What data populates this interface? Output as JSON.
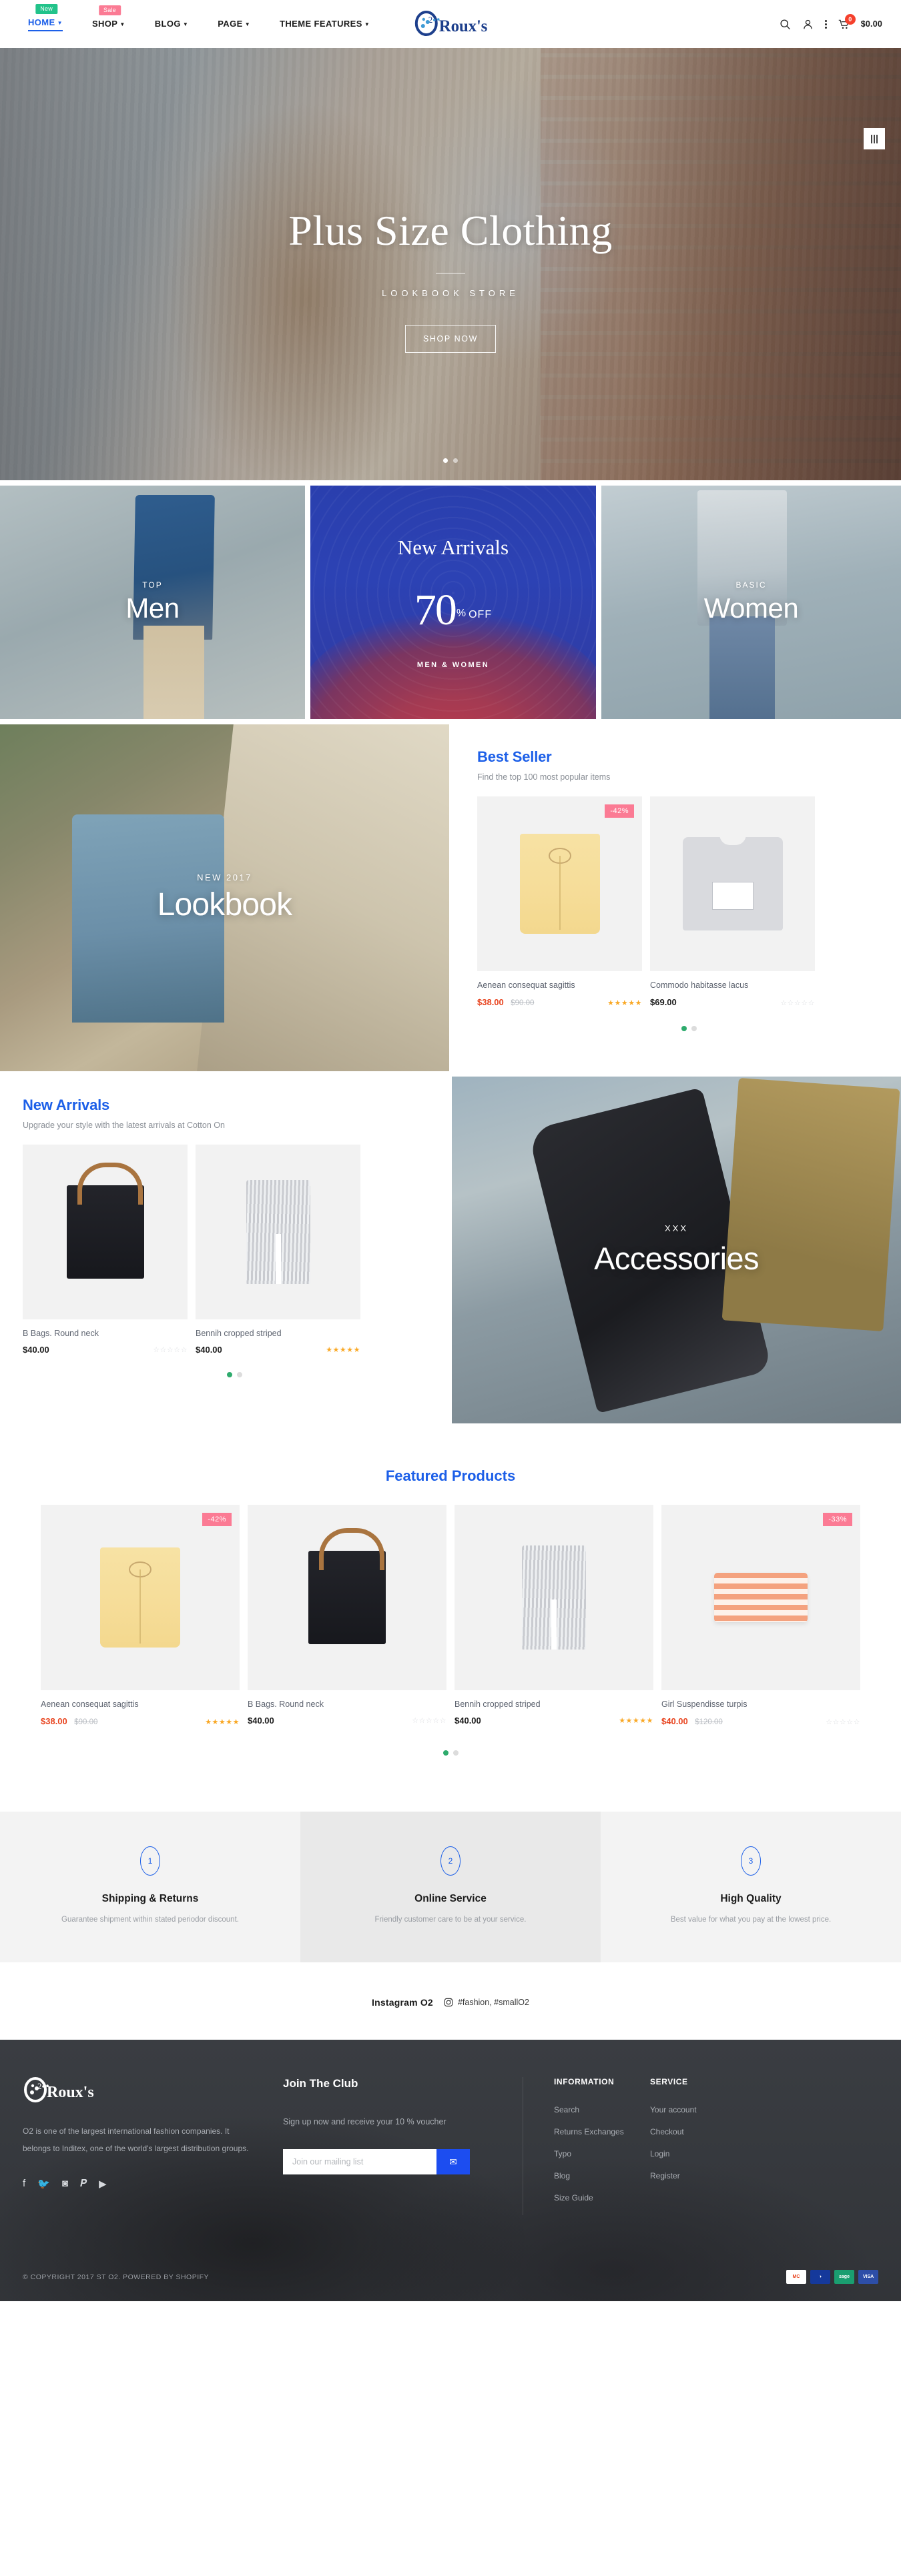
{
  "header": {
    "nav": [
      {
        "label": "HOME",
        "badge": "New",
        "badge_type": "new",
        "active": true,
        "caret": true
      },
      {
        "label": "SHOP",
        "badge": "Sale",
        "badge_type": "sale",
        "active": false,
        "caret": true
      },
      {
        "label": "BLOG",
        "badge": null,
        "active": false,
        "caret": true
      },
      {
        "label": "PAGE",
        "badge": null,
        "active": false,
        "caret": true
      },
      {
        "label": "THEME FEATURES",
        "badge": null,
        "active": false,
        "caret": true
      }
    ],
    "logo_text": "Roux's",
    "logo_mark": "o2-circle-logo",
    "icons": [
      "search-icon",
      "user-icon",
      "more-dots-icon",
      "cart-icon"
    ],
    "cart_count": "0",
    "cart_total": "$0.00"
  },
  "hero": {
    "title": "Plus Size Clothing",
    "subtitle": "LOOKBOOK STORE",
    "button": "SHOP NOW",
    "slides": 2,
    "active_slide": 1
  },
  "categories": [
    {
      "kicker": "TOP",
      "title": "Men"
    },
    {
      "kicker": "",
      "title": "New Arrivals",
      "percent": "70",
      "symbol": "%",
      "off": "OFF",
      "sub": "MEN & WOMEN"
    },
    {
      "kicker": "BASIC",
      "title": "Women"
    }
  ],
  "lookbook": {
    "kicker": "NEW 2017",
    "title": "Lookbook"
  },
  "best_seller": {
    "title": "Best Seller",
    "subtitle": "Find the top 100 most popular items",
    "products": [
      {
        "name": "Aenean consequat sagittis",
        "price": "$38.00",
        "old_price": "$90.00",
        "discount": "-42%",
        "rating": 4.5,
        "art": "shorts"
      },
      {
        "name": "Commodo habitasse lacus",
        "price": "$69.00",
        "old_price": null,
        "discount": null,
        "rating": 0,
        "art": "tee"
      }
    ],
    "dots": 2,
    "active_dot": 1
  },
  "new_arrivals": {
    "title": "New Arrivals",
    "subtitle": "Upgrade your style with the latest arrivals at Cotton On",
    "products": [
      {
        "name": "B Bags. Round neck",
        "price": "$40.00",
        "old_price": null,
        "discount": null,
        "rating": 0,
        "art": "bag"
      },
      {
        "name": "Bennih cropped striped",
        "price": "$40.00",
        "old_price": null,
        "discount": null,
        "rating": 5,
        "art": "pants"
      }
    ],
    "dots": 2,
    "active_dot": 1
  },
  "accessories": {
    "kicker": "XXX",
    "title": "Accessories"
  },
  "featured": {
    "title": "Featured Products",
    "products": [
      {
        "name": "Aenean consequat sagittis",
        "price": "$38.00",
        "old_price": "$90.00",
        "discount": "-42%",
        "rating": 4.5,
        "art": "shorts"
      },
      {
        "name": "B Bags. Round neck",
        "price": "$40.00",
        "old_price": null,
        "discount": null,
        "rating": 0,
        "art": "bag"
      },
      {
        "name": "Bennih cropped striped",
        "price": "$40.00",
        "old_price": null,
        "discount": null,
        "rating": 5,
        "art": "pants"
      },
      {
        "name": "Girl Suspendisse turpis",
        "price": "$40.00",
        "old_price": "$120.00",
        "discount": "-33%",
        "rating": 0,
        "art": "towel"
      }
    ],
    "dots": 2,
    "active_dot": 1
  },
  "services": [
    {
      "num": "1",
      "title": "Shipping & Returns",
      "text": "Guarantee shipment within stated periodor discount."
    },
    {
      "num": "2",
      "title": "Online Service",
      "text": "Friendly customer care to be at your service."
    },
    {
      "num": "3",
      "title": "High Quality",
      "text": "Best value for what you pay at the lowest price."
    }
  ],
  "instagram": {
    "title": "Instagram O2",
    "tags": "#fashion, #smallO2",
    "icon": "instagram-icon"
  },
  "footer": {
    "logo_text": "Roux's",
    "about": "O2 is one of the largest international fashion companies. It belongs to Inditex, one of the world's largest distribution groups.",
    "social": [
      "facebook-icon",
      "twitter-icon",
      "instagram-icon",
      "pinterest-icon",
      "youtube-icon"
    ],
    "club": {
      "title": "Join The Club",
      "text": "Sign up now and receive your 10 % voucher",
      "placeholder": "Join our mailing list",
      "submit_icon": "envelope-icon"
    },
    "information": {
      "head": "INFORMATION",
      "links": [
        "Search",
        "Returns Exchanges",
        "Typo",
        "Blog",
        "Size Guide"
      ]
    },
    "service": {
      "head": "SERVICE",
      "links": [
        "Your account",
        "Checkout",
        "Login",
        "Register"
      ]
    },
    "copyright": "© COPYRIGHT 2017 ST O2. POWERED BY SHOPIFY",
    "payments": [
      "mastercard",
      "diners",
      "sage",
      "visa"
    ],
    "payment_labels": [
      "MC",
      "◑",
      "sage",
      "VISA"
    ]
  },
  "colors": {
    "accent": "#1c5fe8",
    "sale": "#fb7b94",
    "price": "#e8441f",
    "badge_new": "#22c38a",
    "cart": "#f5402c"
  }
}
